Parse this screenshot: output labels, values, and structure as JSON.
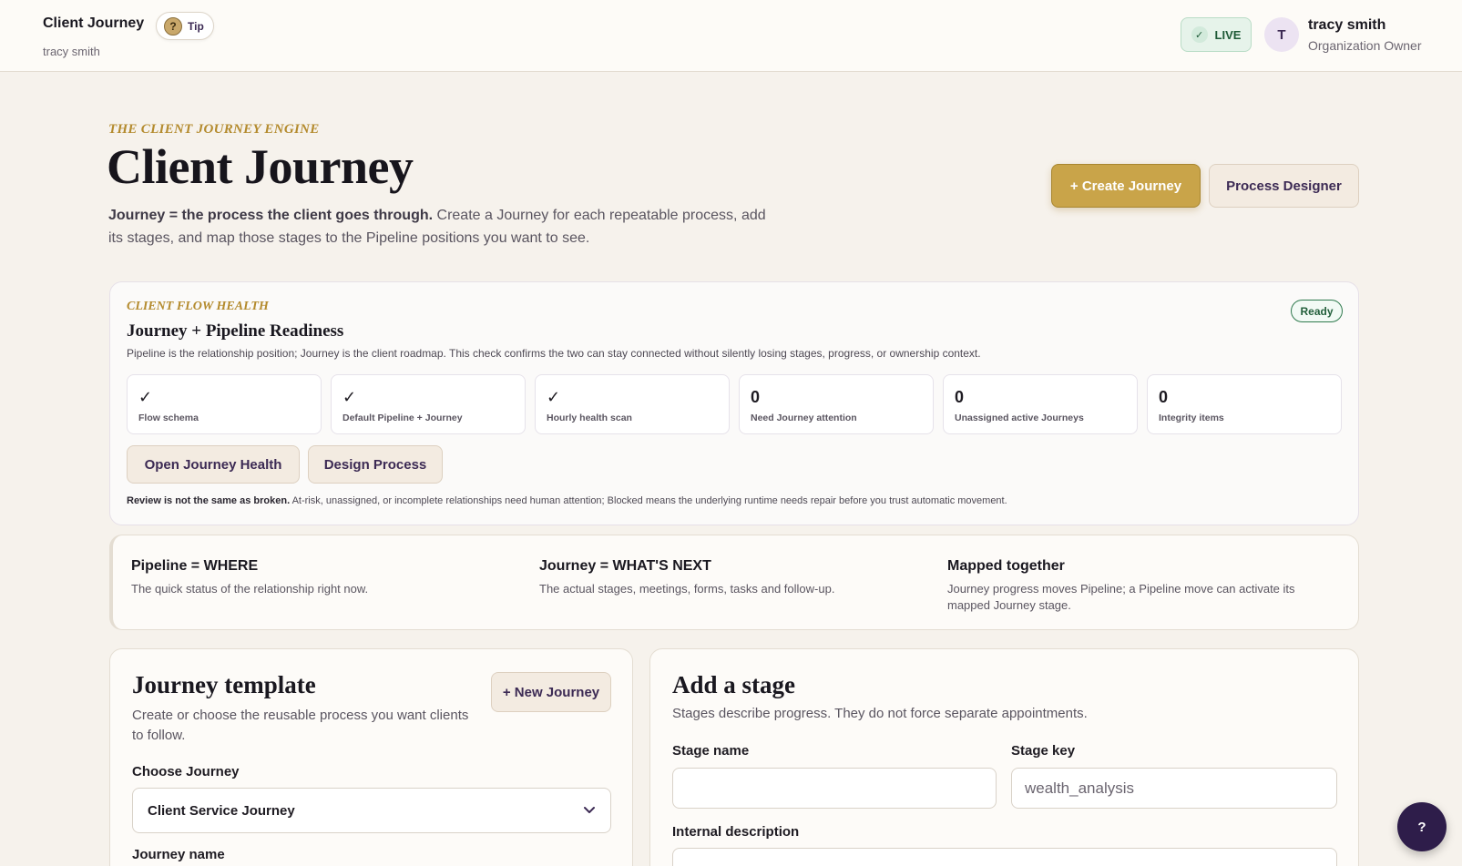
{
  "header": {
    "app_title": "Client Journey",
    "user_name": "tracy smith",
    "tip_label": "Tip",
    "tip_icon_glyph": "?",
    "live_label": "LIVE",
    "live_icon_glyph": "✓",
    "avatar_initial": "T",
    "profile_name": "tracy smith",
    "profile_role": "Organization Owner"
  },
  "hero": {
    "eyebrow": "THE CLIENT JOURNEY ENGINE",
    "title": "Client Journey",
    "lead_strong": "Journey = the process the client goes through.",
    "lead_rest": " Create a Journey for each repeatable process, add its stages, and map those stages to the Pipeline positions you want to see.",
    "create_button": "+ Create Journey",
    "designer_button": "Process Designer"
  },
  "health": {
    "eyebrow": "CLIENT FLOW HEALTH",
    "title": "Journey + Pipeline Readiness",
    "description": "Pipeline is the relationship position; Journey is the client roadmap. This check confirms the two can stay connected without silently losing stages, progress, or ownership context.",
    "status_badge": "Ready",
    "metrics": [
      {
        "value": "✓",
        "label": "Flow schema"
      },
      {
        "value": "✓",
        "label": "Default Pipeline + Journey"
      },
      {
        "value": "✓",
        "label": "Hourly health scan"
      },
      {
        "value": "0",
        "label": "Need Journey attention"
      },
      {
        "value": "0",
        "label": "Unassigned active Journeys"
      },
      {
        "value": "0",
        "label": "Integrity items"
      }
    ],
    "open_health_button": "Open Journey Health",
    "design_process_button": "Design Process",
    "note_strong": "Review is not the same as broken.",
    "note_rest": " At-risk, unassigned, or incomplete relationships need human attention; Blocked means the underlying runtime needs repair before you trust automatic movement."
  },
  "concepts": [
    {
      "title": "Pipeline = WHERE",
      "text": "The quick status of the relationship right now."
    },
    {
      "title": "Journey = WHAT'S NEXT",
      "text": "The actual stages, meetings, forms, tasks and follow-up."
    },
    {
      "title": "Mapped together",
      "text": "Journey progress moves Pipeline; a Pipeline move can activate its mapped Journey stage."
    }
  ],
  "template": {
    "title": "Journey template",
    "description": "Create or choose the reusable process you want clients to follow.",
    "new_button": "+ New Journey",
    "choose_label": "Choose Journey",
    "selected_journey": "Client Service Journey",
    "name_label": "Journey name"
  },
  "stage": {
    "title": "Add a stage",
    "description": "Stages describe progress. They do not force separate appointments.",
    "name_label": "Stage name",
    "name_value": "",
    "key_label": "Stage key",
    "key_placeholder": "wealth_analysis",
    "description_label": "Internal description"
  },
  "help_button": "?",
  "colors": {
    "gold": "#c9a449",
    "purple": "#3c2a54",
    "page_bg": "#f6f2ec",
    "ready_green": "#23603c"
  }
}
